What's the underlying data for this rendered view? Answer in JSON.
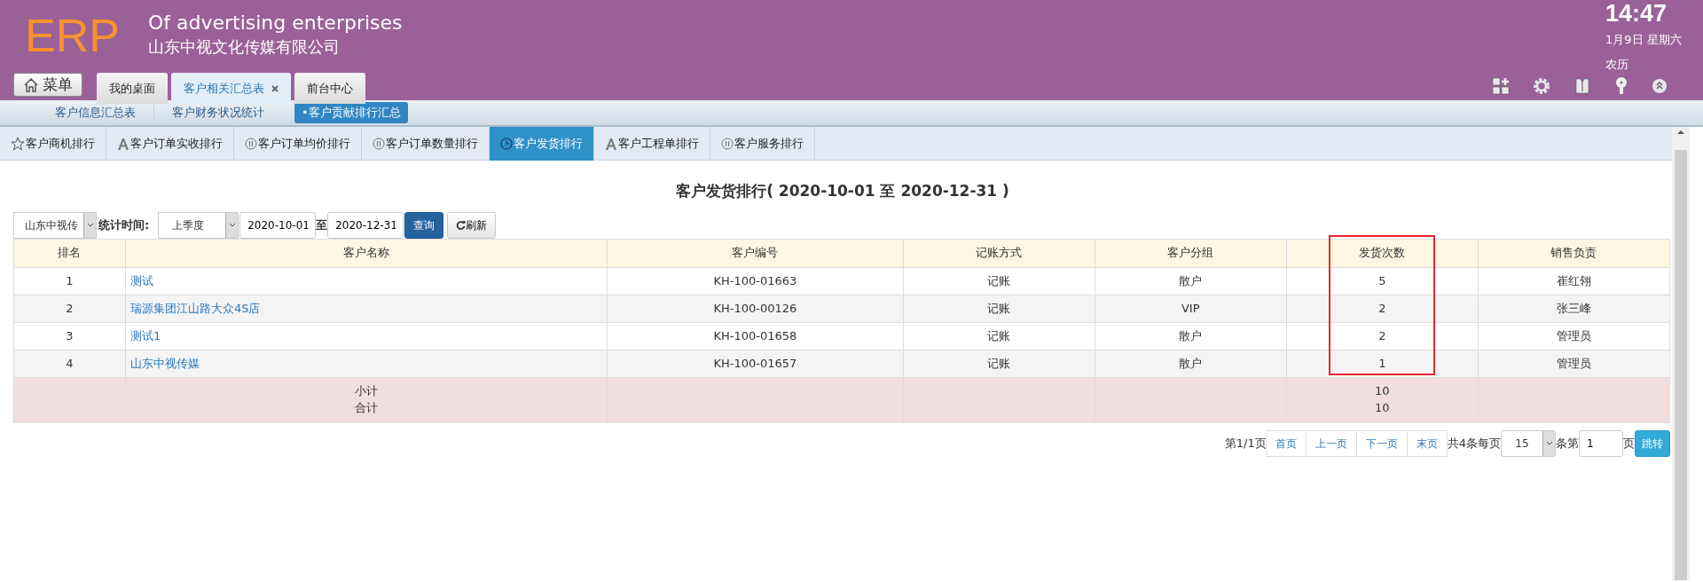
{
  "header": {
    "logo": "ERP",
    "subtitle": "Of advertising enterprises",
    "company": "山东中视文化传媒有限公司",
    "clock": {
      "time": "14:47",
      "date": "1月9日 星期六",
      "lunar": "农历"
    }
  },
  "menu_button": "菜单",
  "window_tabs": [
    {
      "label": "我的桌面",
      "selected": false,
      "closable": false
    },
    {
      "label": "客户相关汇总表",
      "selected": true,
      "closable": true
    },
    {
      "label": "前台中心",
      "selected": false,
      "closable": false
    }
  ],
  "sub_nav": [
    {
      "label": "客户信息汇总表",
      "selected": false
    },
    {
      "label": "客户财务状况统计",
      "selected": false
    },
    {
      "label": "•客户贡献排行汇总",
      "selected": true
    }
  ],
  "rank_tabs": [
    {
      "label": "客户商机排行",
      "selected": false
    },
    {
      "label": "客户订单实收排行",
      "selected": false
    },
    {
      "label": "客户订单均价排行",
      "selected": false
    },
    {
      "label": "客户订单数量排行",
      "selected": false
    },
    {
      "label": "客户发货排行",
      "selected": true
    },
    {
      "label": "客户工程单排行",
      "selected": false
    },
    {
      "label": "客户服务排行",
      "selected": false
    }
  ],
  "report": {
    "title": "客户发货排行( 2020-10-01 至 2020-12-31 )",
    "filters": {
      "company": "山东中视传",
      "time_label": "统计时间:",
      "period": "上季度",
      "start": "2020-10-01",
      "to": "至",
      "end": "2020-12-31",
      "query": "查询",
      "refresh": "刷新"
    },
    "table": {
      "columns": [
        {
          "label": "排名",
          "highlighted": false
        },
        {
          "label": "客户名称",
          "highlighted": false
        },
        {
          "label": "客户编号",
          "highlighted": false
        },
        {
          "label": "记账方式",
          "highlighted": false
        },
        {
          "label": "客户分组",
          "highlighted": false
        },
        {
          "label": "发货次数",
          "highlighted": true
        },
        {
          "label": "销售负责",
          "highlighted": false
        }
      ],
      "rows": [
        [
          "1",
          "测试",
          "KH-100-01663",
          "记账",
          "散户",
          "5",
          "崔红翎"
        ],
        [
          "2",
          "瑞源集团江山路大众4S店",
          "KH-100-00126",
          "记账",
          "VIP",
          "2",
          "张三峰"
        ],
        [
          "3",
          "测试1",
          "KH-100-01658",
          "记账",
          "散户",
          "2",
          "管理员"
        ],
        [
          "4",
          "山东中视传媒",
          "KH-100-01657",
          "记账",
          "散户",
          "1",
          "管理员"
        ]
      ],
      "totals": {
        "labels": [
          "小计",
          "合计"
        ],
        "values": [
          "10",
          "10"
        ]
      }
    },
    "pagination": {
      "page_info": "第1/1页",
      "buttons": [
        "首页",
        "上一页",
        "下一页",
        "末页"
      ],
      "count_text": "共4条每页",
      "page_size": "15",
      "page_label": "条第",
      "page": "1",
      "page_suffix": "页",
      "go": "跳转"
    }
  }
}
